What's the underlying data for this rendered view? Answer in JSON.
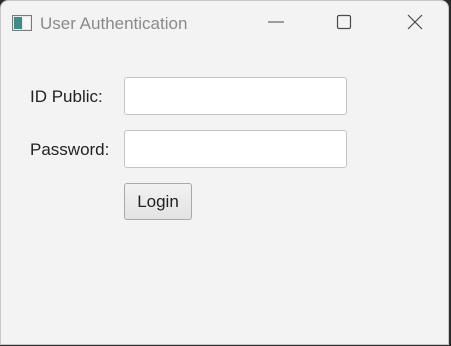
{
  "window": {
    "title": "User Authentication",
    "icons": {
      "app": "app-window-icon",
      "minimize": "minimize-icon",
      "maximize": "maximize-icon",
      "close": "close-icon"
    }
  },
  "form": {
    "id_label": "ID Public:",
    "id_value": "",
    "password_label": "Password:",
    "password_value": "",
    "login_label": "Login"
  },
  "colors": {
    "window_bg": "#f3f3f3",
    "title_text": "#8a8a8a",
    "input_border": "#c4c4c4",
    "button_border": "#a9a9a9"
  }
}
